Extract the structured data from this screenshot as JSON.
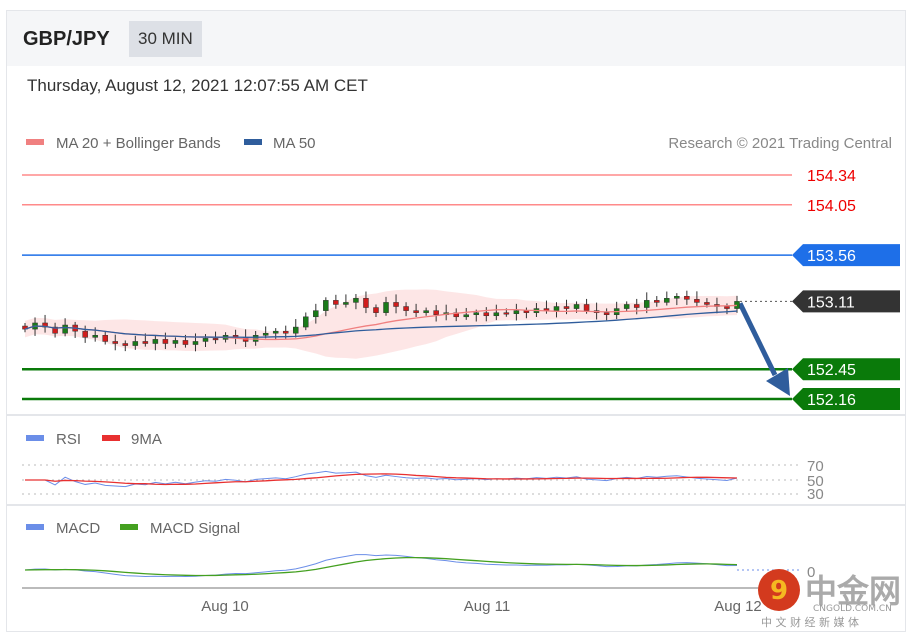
{
  "header": {
    "pair": "GBP/JPY",
    "timeframe": "30 MIN"
  },
  "date": "Thursday, August 12, 2021 12:07:55 AM CET",
  "legend": {
    "ma20": "MA 20 + Bollinger Bands",
    "ma50": "MA 50",
    "credit": "Research © 2021 Trading Central"
  },
  "colors": {
    "ma20": "#f08080",
    "ma50": "#2f5d9c",
    "resistance": "#ff8a8a",
    "pivot": "#1e6fe8",
    "support": "#0a7a0a",
    "current": "#333333",
    "arrow": "#2f5d9c",
    "rsi": "#6b8ee8",
    "rsi_ma": "#e83030",
    "macd": "#6b8ee8",
    "signal": "#44a020"
  },
  "levels": {
    "r2": "154.34",
    "r1": "154.05",
    "pivot": "153.56",
    "current": "153.11",
    "s1": "152.45",
    "s2": "152.16"
  },
  "rsi": {
    "label": "RSI",
    "ma_label": "9MA",
    "ticks": [
      "70",
      "50",
      "30"
    ]
  },
  "macd": {
    "label": "MACD",
    "signal_label": "MACD Signal",
    "tick": "0"
  },
  "xaxis": [
    "Aug 10",
    "Aug 11",
    "Aug 12"
  ],
  "watermark": {
    "name": "中金网",
    "domain": "CNGOLD.COM.CN",
    "tagline": "中 文 财 经 新 媒 体"
  },
  "closes": [
    152.84,
    152.9,
    152.86,
    152.8,
    152.88,
    152.82,
    152.76,
    152.78,
    152.72,
    152.7,
    152.68,
    152.72,
    152.7,
    152.74,
    152.7,
    152.73,
    152.69,
    152.72,
    152.75,
    152.74,
    152.78,
    152.76,
    152.72,
    152.78,
    152.8,
    152.82,
    152.8,
    152.86,
    152.96,
    153.02,
    153.12,
    153.08,
    153.1,
    153.14,
    153.05,
    153.0,
    153.1,
    153.06,
    153.02,
    153.0,
    153.02,
    152.98,
    153.0,
    152.96,
    152.98,
    153.0,
    152.97,
    153.0,
    152.99,
    153.02,
    153.0,
    153.04,
    153.02,
    153.06,
    153.04,
    153.08,
    153.02,
    153.0,
    152.98,
    153.04,
    153.08,
    153.05,
    153.12,
    153.1,
    153.14,
    153.16,
    153.13,
    153.1,
    153.08,
    153.06,
    153.04,
    153.11
  ]
}
